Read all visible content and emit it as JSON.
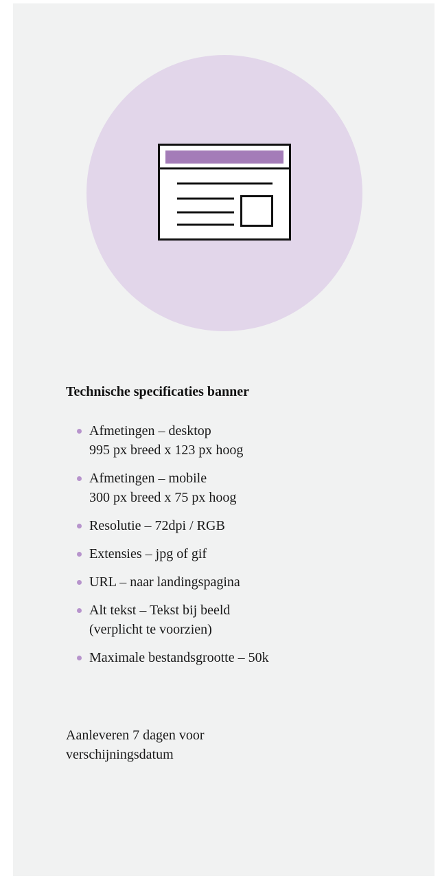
{
  "colors": {
    "card_background": "#f1f2f2",
    "circle_background": "#e2d6ea",
    "icon_header_bar": "#a47cb8",
    "icon_stroke": "#111111",
    "bullet": "#b794cc"
  },
  "illustration": {
    "icon": "browser-window-icon"
  },
  "spec": {
    "title": "Technische specificaties banner",
    "items": [
      {
        "lines": [
          "Afmetingen – desktop",
          "995 px breed x 123 px hoog"
        ]
      },
      {
        "lines": [
          "Afmetingen – mobile",
          "300 px breed x 75 px hoog"
        ]
      },
      {
        "lines": [
          "Resolutie – 72dpi / RGB"
        ]
      },
      {
        "lines": [
          "Extensies – jpg of gif"
        ]
      },
      {
        "lines": [
          "URL – naar landingspagina"
        ]
      },
      {
        "lines": [
          "Alt tekst – Tekst bij beeld",
          "(verplicht te voorzien)"
        ]
      },
      {
        "lines": [
          "Maximale bestandsgrootte – 50k"
        ]
      }
    ]
  },
  "delivery": {
    "text": "Aanleveren 7 dagen voor verschijningsdatum"
  }
}
